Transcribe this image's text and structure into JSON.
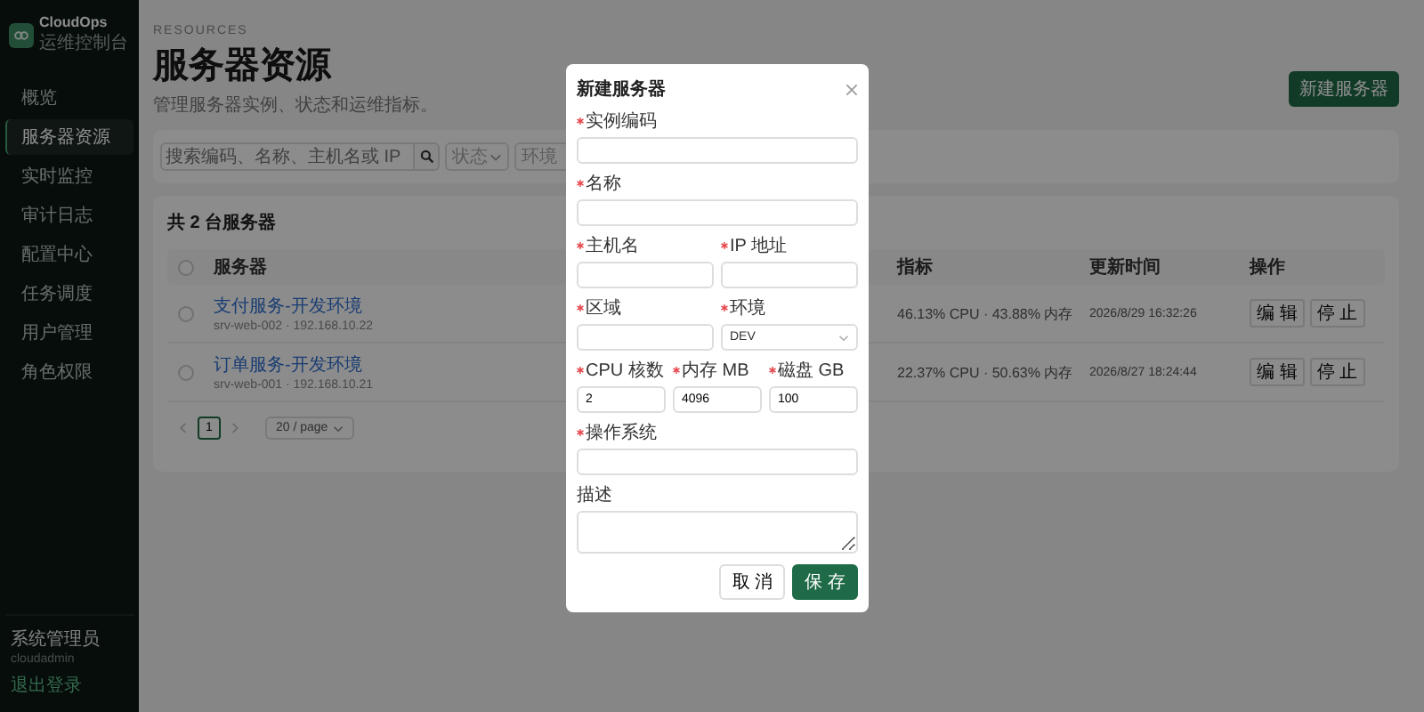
{
  "sidebar": {
    "brand": "CloudOps",
    "subtitle": "运维控制台",
    "items": [
      {
        "label": "概览",
        "selected": false
      },
      {
        "label": "服务器资源",
        "selected": true
      },
      {
        "label": "实时监控",
        "selected": false
      },
      {
        "label": "审计日志",
        "selected": false
      },
      {
        "label": "配置中心",
        "selected": false
      },
      {
        "label": "任务调度",
        "selected": false
      },
      {
        "label": "用户管理",
        "selected": false
      },
      {
        "label": "角色权限",
        "selected": false
      }
    ],
    "user": {
      "name": "系统管理员",
      "account": "cloudadmin",
      "logout": "退出登录"
    }
  },
  "header": {
    "eyebrow": "RESOURCES",
    "title": "服务器资源",
    "description": "管理服务器实例、状态和运维指标。",
    "new_button": "新建服务器"
  },
  "filters": {
    "search_placeholder": "搜索编码、名称、主机名或 IP",
    "status_placeholder": "状态",
    "env_placeholder": "环境"
  },
  "table": {
    "title": "共 2 台服务器",
    "select_all": {
      "checked": false
    },
    "columns": [
      "服务器",
      "指标",
      "更新时间",
      "操作"
    ],
    "rows": [
      {
        "checked": false,
        "name": "支付服务-开发环境",
        "host": "srv-web-002 · 192.168.10.22",
        "metrics": "46.13% CPU · 43.88% 内存",
        "updated": "2026/8/29 16:32:26",
        "actions": [
          "编 辑",
          "停 止"
        ]
      },
      {
        "checked": false,
        "name": "订单服务-开发环境",
        "host": "srv-web-001 · 192.168.10.21",
        "metrics": "22.37% CPU · 50.63% 内存",
        "updated": "2026/8/27 18:24:44",
        "actions": [
          "编 辑",
          "停 止"
        ]
      }
    ],
    "pagination": {
      "page": "1",
      "page_size": "20 / page"
    }
  },
  "modal": {
    "title": "新建服务器",
    "rows": [
      [
        {
          "label": "实例编码",
          "required": true,
          "kind": "input"
        }
      ],
      [
        {
          "label": "名称",
          "required": true,
          "kind": "input"
        }
      ],
      [
        {
          "label": "主机名",
          "required": true,
          "kind": "input"
        },
        {
          "label": "IP 地址",
          "required": true,
          "kind": "input"
        }
      ],
      [
        {
          "label": "区域",
          "required": true,
          "kind": "input"
        },
        {
          "label": "环境",
          "required": true,
          "kind": "select",
          "value": "DEV"
        }
      ],
      [
        {
          "label": "CPU 核数",
          "required": true,
          "kind": "input",
          "value": "2"
        },
        {
          "label": "内存 MB",
          "required": true,
          "kind": "input",
          "value": "4096"
        },
        {
          "label": "磁盘 GB",
          "required": true,
          "kind": "input",
          "value": "100"
        }
      ],
      [
        {
          "label": "操作系统",
          "required": true,
          "kind": "input"
        }
      ],
      [
        {
          "label": "描述",
          "required": false,
          "kind": "textarea"
        }
      ]
    ],
    "buttons": [
      {
        "label": "取 消",
        "kind": "secondary"
      },
      {
        "label": "保 存",
        "kind": "primary"
      }
    ]
  }
}
